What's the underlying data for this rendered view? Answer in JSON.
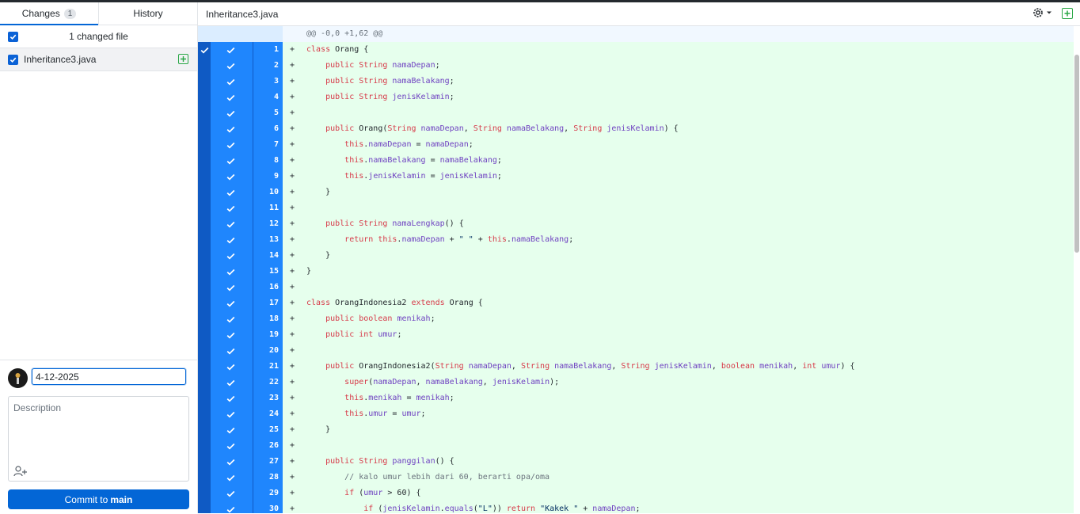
{
  "tabs": [
    {
      "label": "Changes",
      "count": "1"
    },
    {
      "label": "History"
    }
  ],
  "changes": {
    "summary_label": "1 changed file",
    "files": [
      {
        "name": "Inheritance3.java",
        "status": "added"
      }
    ]
  },
  "commit": {
    "summary_value": "4-12-2025",
    "description_placeholder": "Description",
    "button_prefix": "Commit to",
    "branch": "main"
  },
  "diff": {
    "file_title": "Inheritance3.java",
    "hunk_header": "@@ -0,0 +1,62 @@",
    "lines": [
      "class Orang {",
      "    public String namaDepan;",
      "    public String namaBelakang;",
      "    public String jenisKelamin;",
      "",
      "    public Orang(String namaDepan, String namaBelakang, String jenisKelamin) {",
      "        this.namaDepan = namaDepan;",
      "        this.namaBelakang = namaBelakang;",
      "        this.jenisKelamin = jenisKelamin;",
      "    }",
      "",
      "    public String namaLengkap() {",
      "        return this.namaDepan + \" \" + this.namaBelakang;",
      "    }",
      "}",
      "",
      "class OrangIndonesia2 extends Orang {",
      "    public boolean menikah;",
      "    public int umur;",
      "",
      "    public OrangIndonesia2(String namaDepan, String namaBelakang, String jenisKelamin, boolean menikah, int umur) {",
      "        super(namaDepan, namaBelakang, jenisKelamin);",
      "        this.menikah = menikah;",
      "        this.umur = umur;",
      "    }",
      "",
      "    public String panggilan() {",
      "        // kalo umur lebih dari 60, berarti opa/oma",
      "        if (umur > 60) {",
      "            if (jenisKelamin.equals(\"L\")) return \"Kakek \" + namaDepan;"
    ]
  },
  "colors": {
    "accent": "#0366d6",
    "added_bg": "#e6ffed",
    "gutter_selected": "#1f86fd",
    "added_icon": "#28a745"
  },
  "icons": [
    "checkbox-checked-icon",
    "file-added-icon",
    "gear-icon",
    "chevron-down-icon",
    "expand-icon",
    "add-coauthor-icon",
    "avatar"
  ]
}
